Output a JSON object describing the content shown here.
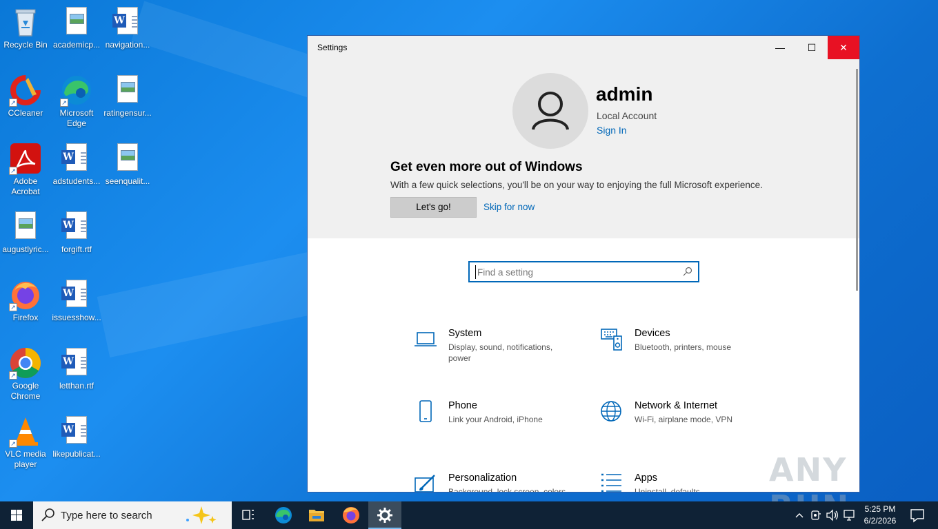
{
  "desktop": {
    "icons": [
      {
        "label": "Recycle Bin"
      },
      {
        "label": "academicp..."
      },
      {
        "label": "navigation..."
      },
      {
        "label": "CCleaner"
      },
      {
        "label": "Microsoft Edge"
      },
      {
        "label": "ratingensur..."
      },
      {
        "label": "Adobe Acrobat"
      },
      {
        "label": "adstudents..."
      },
      {
        "label": "seenqualit..."
      },
      {
        "label": "augustlyric..."
      },
      {
        "label": "forgift.rtf"
      },
      {
        "label": "Firefox"
      },
      {
        "label": "issuesshow..."
      },
      {
        "label": "Google Chrome"
      },
      {
        "label": "letthan.rtf"
      },
      {
        "label": "VLC media player"
      },
      {
        "label": "likepublicat..."
      }
    ]
  },
  "window": {
    "title": "Settings",
    "minimize_glyph": "—",
    "maximize_glyph": "☐",
    "close_glyph": "✕"
  },
  "account": {
    "username": "admin",
    "type": "Local Account",
    "sign_in": "Sign In"
  },
  "promo": {
    "title": "Get even more out of Windows",
    "text": "With a few quick selections, you'll be on your way to enjoying the full Microsoft experience.",
    "primary": "Let's go!",
    "secondary": "Skip for now"
  },
  "search": {
    "placeholder": "Find a setting"
  },
  "categories": [
    {
      "name": "System",
      "desc": "Display, sound, notifications, power",
      "icon": "laptop-icon"
    },
    {
      "name": "Devices",
      "desc": "Bluetooth, printers, mouse",
      "icon": "keyboard-speaker-icon"
    },
    {
      "name": "Phone",
      "desc": "Link your Android, iPhone",
      "icon": "phone-icon"
    },
    {
      "name": "Network & Internet",
      "desc": "Wi-Fi, airplane mode, VPN",
      "icon": "globe-icon"
    },
    {
      "name": "Personalization",
      "desc": "Background, lock screen, colors",
      "icon": "brush-icon"
    },
    {
      "name": "Apps",
      "desc": "Uninstall, defaults",
      "icon": "apps-list-icon"
    }
  ],
  "taskbar": {
    "search_placeholder": "Type here to search",
    "time": "5:25 PM",
    "date": "6/2/2026"
  },
  "watermark": "ANY RUN",
  "colors": {
    "accent": "#0067b8",
    "close": "#e81123",
    "taskbar": "#0f2236"
  }
}
